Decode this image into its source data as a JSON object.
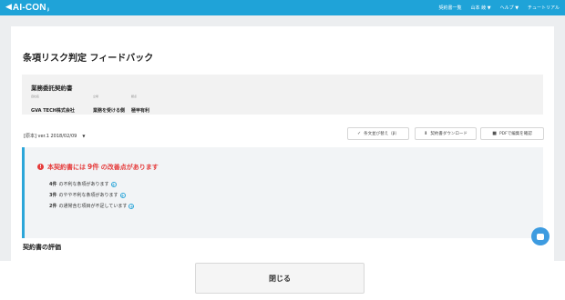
{
  "header": {
    "logo_text": "AI-CON",
    "logo_sub": "β",
    "nav": {
      "contracts": "契約書一覧",
      "user": "山本 綾",
      "help": "ヘルプ",
      "tutorial": "チュートリアル"
    }
  },
  "page": {
    "title": "条項リスク判定 フィードバック"
  },
  "document": {
    "title": "業務委託契約書",
    "parties": [
      {
        "label": "自社名",
        "value": "GVA TECH株式会社"
      },
      {
        "label": "立場",
        "value": "業務を受ける側"
      },
      {
        "label": "観点",
        "value": "極甲有利"
      }
    ]
  },
  "toolbar": {
    "version": "[原本] ver.1 2018/02/09",
    "btn_sort": "条文並び替え（β）",
    "btn_download": "契約書ダウンロード",
    "btn_pdf": "PDFで編集を確認"
  },
  "alert": {
    "prefix": "本契約書には",
    "count": "9件",
    "suffix": "の改善点があります",
    "items": [
      {
        "num": "4件",
        "text": "の不利な条項があります"
      },
      {
        "num": "3件",
        "text": "のやや不利な条項があります"
      },
      {
        "num": "2件",
        "text": "の通常含む項目が不足しています"
      }
    ]
  },
  "section": {
    "evaluation_title": "契約書の評価"
  },
  "footer": {
    "close_label": "閉じる"
  },
  "colors": {
    "header": "#1fa3d8",
    "alert_red": "#e53a3a",
    "accent_blue": "#2ca6d9",
    "chat_blue": "#3d9be0"
  }
}
